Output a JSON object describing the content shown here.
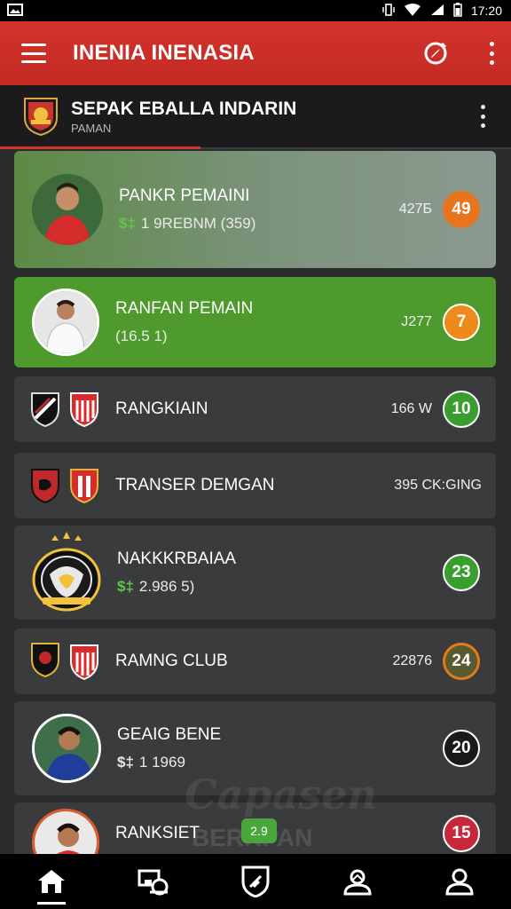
{
  "status_bar": {
    "time": "17:20"
  },
  "app_bar": {
    "title": "INENIA INENASIA"
  },
  "league": {
    "title": "SEPAK EBALLA INDARIN",
    "subtitle": "PAMAN"
  },
  "items": [
    {
      "title": "PANKR PEMAINI",
      "sub": "1 9REBNM (359)",
      "value": "427Б",
      "badge": "49",
      "badge_color": "#e8741e"
    },
    {
      "title": "RANFAN PEMAIN",
      "sub": "(16.5 1)",
      "value": "J277",
      "badge": "7",
      "badge_color": "#ef8a1a"
    },
    {
      "title": "RANGKIAIN",
      "sub": "",
      "value": "166 W",
      "badge": "10",
      "badge_color": "#3a9e2f"
    },
    {
      "title": "TRANSER DEMGAN",
      "sub": "",
      "value": "395 CK:GING",
      "badge": "",
      "badge_color": ""
    },
    {
      "title": "NAKKKRBAIAA",
      "sub": "2.986 5)",
      "value": "",
      "badge": "23",
      "badge_color": "#3a9e2f"
    },
    {
      "title": "RAMNG CLUB",
      "sub": "",
      "value": "22876",
      "badge": "24",
      "badge_color": "#5a5a30"
    },
    {
      "title": "GEAIG BENE",
      "sub": "1 1969",
      "value": "",
      "badge": "20",
      "badge_color": "#1a1a1a"
    },
    {
      "title": "RANKSIET",
      "sub": "",
      "value": "",
      "badge": "15",
      "badge_color": "#c7273a"
    }
  ],
  "overlay": {
    "pill": "2.9",
    "watermark": "Capasen",
    "watermark_sub": "BERKPAN"
  },
  "nav": [
    {
      "label": "home-icon"
    },
    {
      "label": "transfer-icon"
    },
    {
      "label": "shield-icon"
    },
    {
      "label": "upload-icon"
    },
    {
      "label": "profile-icon"
    }
  ]
}
